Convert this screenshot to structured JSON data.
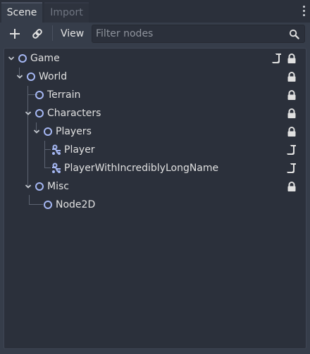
{
  "tabs": [
    {
      "label": "Scene",
      "active": true
    },
    {
      "label": "Import",
      "active": false
    }
  ],
  "toolbar": {
    "add_icon": "plus-icon",
    "link_icon": "link-icon",
    "view_label": "View",
    "filter_placeholder": "Filter nodes",
    "search_icon": "search-icon",
    "menu_icon": "kebab-menu-icon"
  },
  "tree": {
    "nodes": [
      {
        "name": "Game",
        "depth": 0,
        "expanded": true,
        "icon": "node-icon",
        "script": true,
        "locked": true
      },
      {
        "name": "World",
        "depth": 1,
        "expanded": true,
        "icon": "node-icon",
        "script": false,
        "locked": true
      },
      {
        "name": "Terrain",
        "depth": 2,
        "expanded": null,
        "icon": "node-icon",
        "script": false,
        "locked": true
      },
      {
        "name": "Characters",
        "depth": 2,
        "expanded": true,
        "icon": "node-icon",
        "script": false,
        "locked": true
      },
      {
        "name": "Players",
        "depth": 3,
        "expanded": true,
        "icon": "node-icon",
        "script": false,
        "locked": true
      },
      {
        "name": "Player",
        "depth": 4,
        "expanded": null,
        "icon": "instanced-scene-icon",
        "script": true,
        "locked": false
      },
      {
        "name": "PlayerWithIncrediblyLongName",
        "depth": 4,
        "expanded": null,
        "icon": "instanced-scene-icon",
        "script": true,
        "locked": false
      },
      {
        "name": "Misc",
        "depth": 2,
        "expanded": true,
        "icon": "node-icon",
        "script": false,
        "locked": true
      },
      {
        "name": "Node2D",
        "depth": 3,
        "expanded": null,
        "icon": "node-icon",
        "script": false,
        "locked": false
      }
    ]
  },
  "colors": {
    "panel_bg": "#363d4a",
    "tree_bg": "#2b303b",
    "node_icon": "#a5b7f3",
    "text": "#e0e0e0"
  }
}
